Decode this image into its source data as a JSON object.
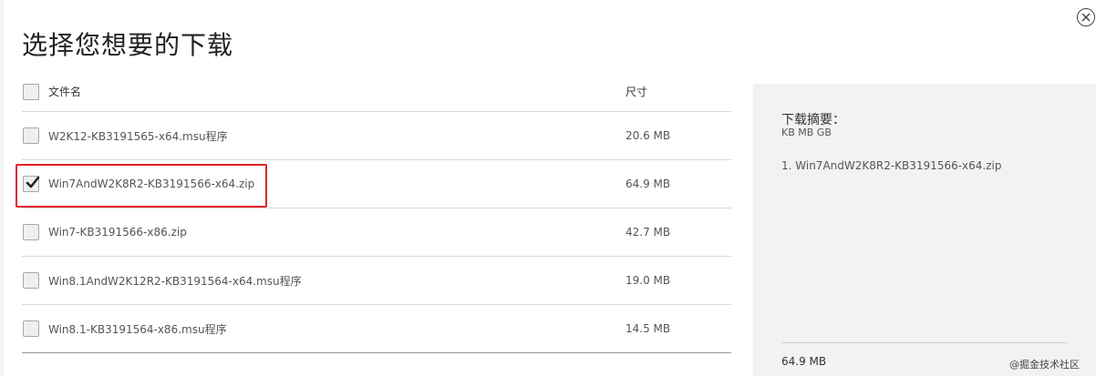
{
  "dialog": {
    "title": "选择您想要的下载",
    "close_label": "×"
  },
  "table": {
    "header": {
      "name": "文件名",
      "size": "尺寸",
      "checked": false
    },
    "rows": [
      {
        "name": "W2K12-KB3191565-x64.msu程序",
        "size": "20.6 MB",
        "checked": false
      },
      {
        "name": "Win7AndW2K8R2-KB3191566-x64.zip",
        "size": "64.9 MB",
        "checked": true
      },
      {
        "name": "Win7-KB3191566-x86.zip",
        "size": "42.7 MB",
        "checked": false
      },
      {
        "name": "Win8.1AndW2K12R2-KB3191564-x64.msu程序",
        "size": "19.0 MB",
        "checked": false
      },
      {
        "name": "Win8.1-KB3191564-x86.msu程序",
        "size": "14.5 MB",
        "checked": false
      }
    ]
  },
  "summary": {
    "title": "下载摘要：",
    "units": "KB MB GB",
    "items": [
      "1. Win7AndW2K8R2-KB3191566-x64.zip"
    ],
    "total": "64.9 MB"
  },
  "watermark": "@掘金技术社区",
  "colors": {
    "highlight": "#e0232b",
    "summary_bg": "#f2f2f2"
  }
}
